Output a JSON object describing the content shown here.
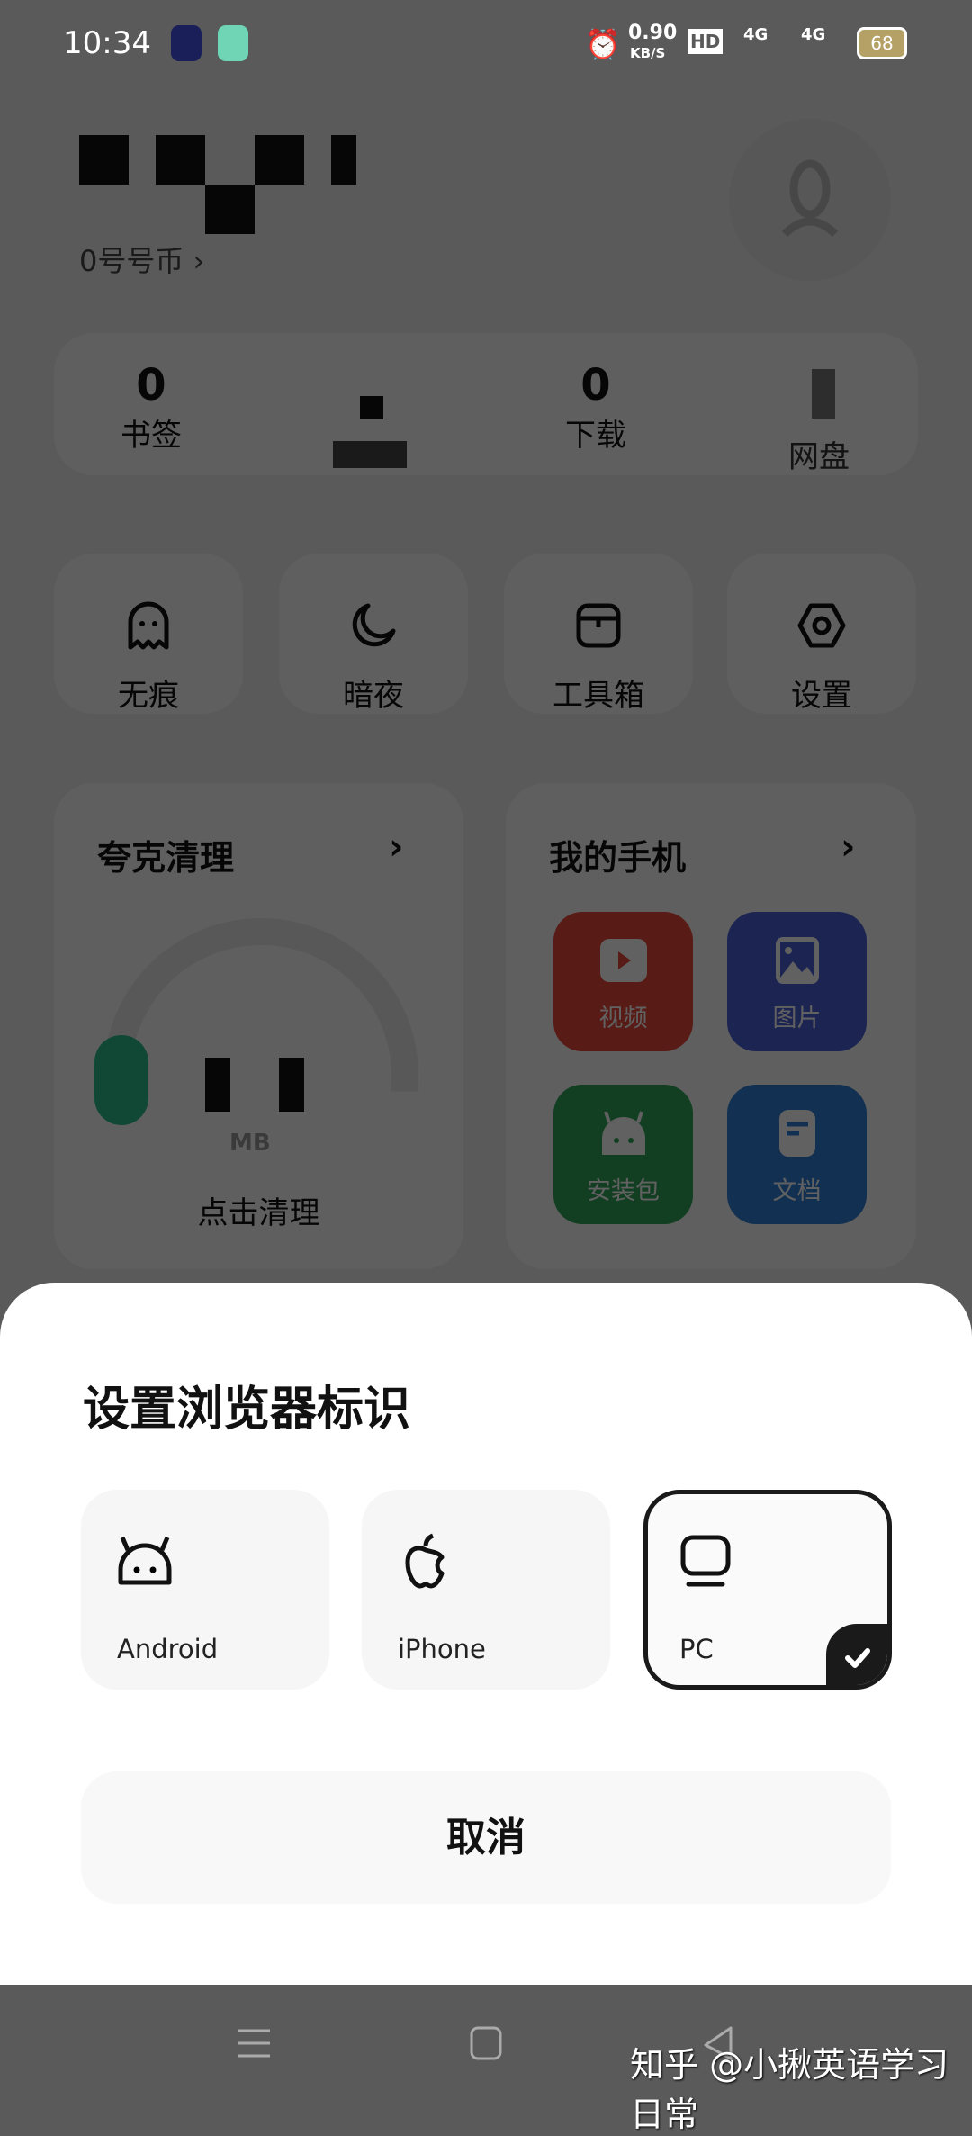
{
  "status_bar": {
    "time": "10:34",
    "net_speed": "0.90",
    "net_unit": "KB/S",
    "hd": "HD",
    "net1": "4G",
    "net2": "4G",
    "battery": "68"
  },
  "profile": {
    "coins": "0号号币",
    "chevron": "›"
  },
  "stats": [
    {
      "value": "0",
      "label": "书签"
    },
    {
      "value": "",
      "label": ""
    },
    {
      "value": "0",
      "label": "下载"
    },
    {
      "value": "",
      "label": "网盘"
    }
  ],
  "quick": [
    {
      "label": "无痕",
      "icon": "ghost-icon"
    },
    {
      "label": "暗夜",
      "icon": "moon-icon"
    },
    {
      "label": "工具箱",
      "icon": "toolbox-icon"
    },
    {
      "label": "设置",
      "icon": "settings-icon"
    }
  ],
  "clean": {
    "title": "夸克清理",
    "unit": "MB",
    "action": "点击清理",
    "accent": "#2dbb8c"
  },
  "phone": {
    "title": "我的手机",
    "tiles": [
      {
        "label": "视频",
        "color": "#e8463a"
      },
      {
        "label": "图片",
        "color": "#4a5fd8"
      },
      {
        "label": "安装包",
        "color": "#2fa65a"
      },
      {
        "label": "文档",
        "color": "#2f7fd6"
      }
    ]
  },
  "sheet": {
    "title": "设置浏览器标识",
    "options": [
      {
        "label": "Android",
        "icon": "android-icon",
        "selected": false
      },
      {
        "label": "iPhone",
        "icon": "apple-icon",
        "selected": false
      },
      {
        "label": "PC",
        "icon": "monitor-icon",
        "selected": true
      }
    ],
    "cancel": "取消"
  },
  "watermark": "知乎 @小揪英语学习日常"
}
